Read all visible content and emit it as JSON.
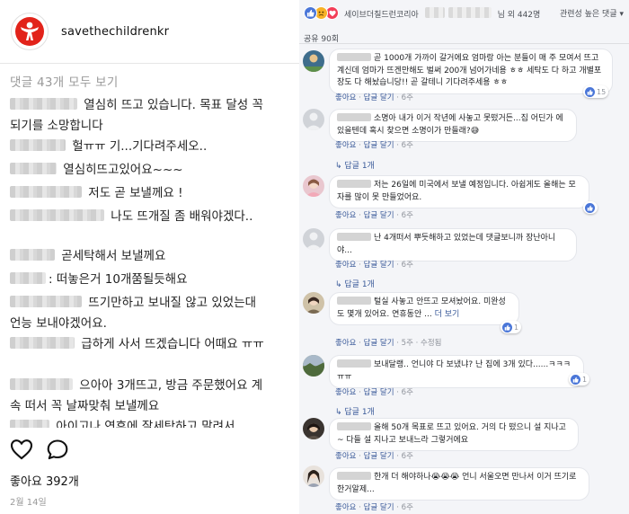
{
  "instagram": {
    "username": "savethechildrenkr",
    "view_all": "댓글 43개 모두 보기",
    "comments": [
      {
        "text": " 열심히 뜨고 있습니다. 목표 달성 꼭 되기를 소망합니다"
      },
      {
        "text": " 헐ㅠㅠ 기...기다려주세오.."
      },
      {
        "text": " 열심히뜨고있어요~~~"
      },
      {
        "text": " 저도 곧 보낼께요 !"
      },
      {
        "text": " 나도 뜨개질 좀 배워야겠다.."
      },
      {
        "text": " 곧세탁해서 보낼께요"
      },
      {
        "text": ": 떠놓은거 10개쭘될듯해요"
      },
      {
        "text": " 뜨기만하고 보내질 않고 있었는대 언능 보내야겠어요."
      },
      {
        "text": " 급하게 사서 뜨겠습니다 어때요 ㅠㅠ"
      },
      {
        "text": " 으아아 3개뜨고, 방금 주문했어요 계속 떠서 꼭 날짜맞춰 보낼께요"
      },
      {
        "text": " 아이고나 연휴에 잘세탁하고 말려서"
      }
    ],
    "likes": "좋아요 392개",
    "date": "2월 14일",
    "icons": [
      "heart-icon",
      "comment-icon"
    ]
  },
  "facebook": {
    "reactions_text_prefix": "세이브더칠드런코리아",
    "reactions_text_suffix": "님 외 442명",
    "sort_label": "관련성 높은 댓글 ▾",
    "shares": "공유 90회",
    "comments": [
      {
        "text": "곧 1000개 가까이 갈거에요 엄마랑 아는 분들이 매 주 모여서 뜨고계신데 엄마가 뜨겐만해도 벌써 200개 넘어가네용 ㅎㅎ 세탁도 다 하고 개별포장도 다 해놨습니당!! 곧 갈테니 기다려주세용 ㅎㅎ",
        "meta_like": "좋아요",
        "meta_reply": "답글 달기",
        "meta_time": "6주",
        "badge": "15",
        "reply": ""
      },
      {
        "text": "소명아 내가 이거 작년에 사놓고 못떴거든...집 어딘가 에있을텐데 혹시 찾으면 소명이가 만들래?😅",
        "meta_like": "좋아요",
        "meta_reply": "답글 달기",
        "meta_time": "6주",
        "badge": "",
        "reply": "↳ 답글 1개"
      },
      {
        "text": "저는 26일에 미국에서 보낼 예정입니다. 아쉽게도 올해는 모자를 많이 못 만들었어요.",
        "meta_like": "좋아요",
        "meta_reply": "답글 달기",
        "meta_time": "6주",
        "badge": "",
        "reply": ""
      },
      {
        "text": "난 4개떠서 뿌듯해하고 있었는데 댓글보니까 장난아니야...",
        "meta_like": "좋아요",
        "meta_reply": "답글 달기",
        "meta_time": "6주",
        "badge": "",
        "reply": "↳ 답글 1개"
      },
      {
        "text": "털실 사놓고 안뜨고 모셔놨어요. 미완성도 몇개 있어요. 연휴동안 ...",
        "more": "더 보기",
        "meta_like": "좋아요",
        "meta_reply": "답글 달기",
        "meta_time": "5주",
        "meta_edited": "수정됨",
        "badge": "1",
        "reply": ""
      },
      {
        "text": "보내달랭.. 언니야 다 보냈냐? 난 집에 3개 있다......ㅋㅋㅋㅠㅠ",
        "meta_like": "좋아요",
        "meta_reply": "답글 달기",
        "meta_time": "6주",
        "badge": "1",
        "reply": "↳ 답글 1개"
      },
      {
        "text": "올해 50개 목표로 뜨고 있어요. 거의 다 떴으니 설 지나고~ 다들 설 지나고 보내느라 그렇거에요",
        "meta_like": "좋아요",
        "meta_reply": "답글 달기",
        "meta_time": "6주",
        "badge": "",
        "reply": ""
      },
      {
        "text": "한개 더 해야하나😭😭😭 언니 서울오면 만나서 이거 뜨기로한거알제...",
        "meta_like": "좋아요",
        "meta_reply": "답글 달기",
        "meta_time": "6주",
        "badge": "",
        "reply": ""
      }
    ]
  },
  "colors": {
    "fb_link": "#385898",
    "fb_like_blue": "#4a76d8",
    "ig_gray": "#9a9a9a",
    "brand_red": "#e2231a"
  }
}
